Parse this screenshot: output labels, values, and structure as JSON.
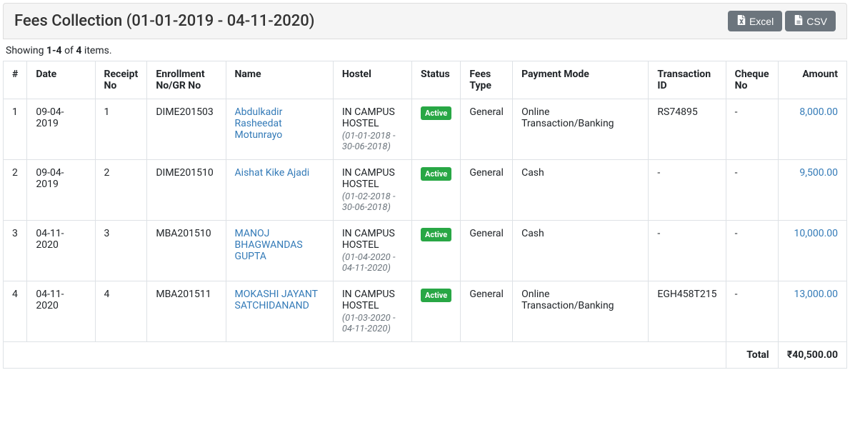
{
  "header": {
    "title": "Fees Collection (01-01-2019 - 04-11-2020)",
    "excel_label": "Excel",
    "csv_label": "CSV"
  },
  "summary": {
    "prefix": "Showing ",
    "range": "1-4",
    "mid": " of ",
    "total": "4",
    "suffix": " items."
  },
  "columns": {
    "idx": "#",
    "date": "Date",
    "receipt": "Receipt No",
    "enroll": "Enrollment No/GR No",
    "name": "Name",
    "hostel": "Hostel",
    "status": "Status",
    "feestype": "Fees Type",
    "payment": "Payment Mode",
    "txn": "Transaction ID",
    "cheque": "Cheque No",
    "amount": "Amount"
  },
  "rows": [
    {
      "idx": "1",
      "date": "09-04-2019",
      "receipt": "1",
      "enroll": "DIME201503",
      "name": "Abdulkadir Rasheedat Motunrayo",
      "hostel_main": "IN CAMPUS HOSTEL",
      "hostel_sub": "(01-01-2018 - 30-06-2018)",
      "status": "Active",
      "feestype": "General",
      "payment": "Online Transaction/Banking",
      "txn": "RS74895",
      "cheque": "-",
      "amount": "8,000.00"
    },
    {
      "idx": "2",
      "date": "09-04-2019",
      "receipt": "2",
      "enroll": "DIME201510",
      "name": "Aishat Kike Ajadi",
      "hostel_main": "IN CAMPUS HOSTEL",
      "hostel_sub": "(01-02-2018 - 30-06-2018)",
      "status": "Active",
      "feestype": "General",
      "payment": "Cash",
      "txn": "-",
      "cheque": "-",
      "amount": "9,500.00"
    },
    {
      "idx": "3",
      "date": "04-11-2020",
      "receipt": "3",
      "enroll": "MBA201510",
      "name": "MANOJ BHAGWANDAS GUPTA",
      "hostel_main": "IN CAMPUS HOSTEL",
      "hostel_sub": "(01-04-2020 - 04-11-2020)",
      "status": "Active",
      "feestype": "General",
      "payment": "Cash",
      "txn": "-",
      "cheque": "-",
      "amount": "10,000.00"
    },
    {
      "idx": "4",
      "date": "04-11-2020",
      "receipt": "4",
      "enroll": "MBA201511",
      "name": "MOKASHI JAYANT SATCHIDANAND",
      "hostel_main": "IN CAMPUS HOSTEL",
      "hostel_sub": "(01-03-2020 - 04-11-2020)",
      "status": "Active",
      "feestype": "General",
      "payment": "Online Transaction/Banking",
      "txn": "EGH458T215",
      "cheque": "-",
      "amount": "13,000.00"
    }
  ],
  "footer": {
    "total_label": "Total",
    "total_amount": "₹40,500.00"
  }
}
